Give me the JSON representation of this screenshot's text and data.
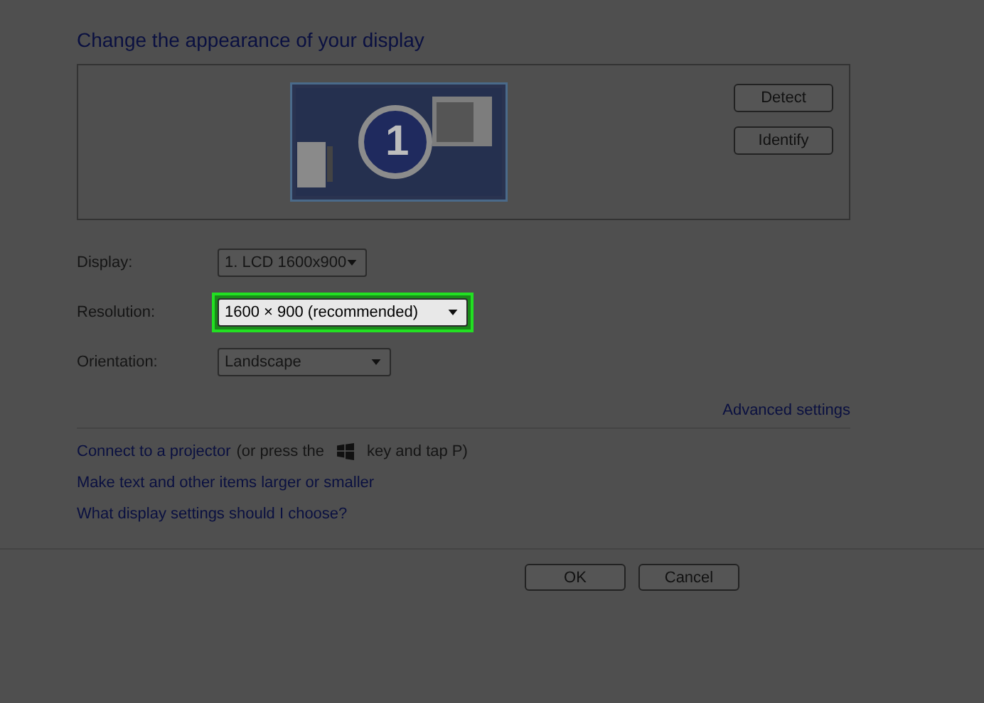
{
  "title": "Change the appearance of your display",
  "monitor_panel": {
    "display_number": "1",
    "buttons": [
      "Detect",
      "Identify"
    ]
  },
  "settings": [
    {
      "label": "Display:",
      "value": "1. LCD 1600x900",
      "highlighted": false
    },
    {
      "label": "Resolution:",
      "value": "1600 × 900 (recommended)",
      "highlighted": true
    },
    {
      "label": "Orientation:",
      "value": "Landscape",
      "highlighted": false
    }
  ],
  "advanced_link": "Advanced settings",
  "projector": {
    "link": "Connect to a projector",
    "before_key": "(or press the",
    "after_key": "key and tap P)"
  },
  "links": [
    "Make text and other items larger or smaller",
    "What display settings should I choose?"
  ],
  "buttons": [
    "OK",
    "Cancel"
  ]
}
